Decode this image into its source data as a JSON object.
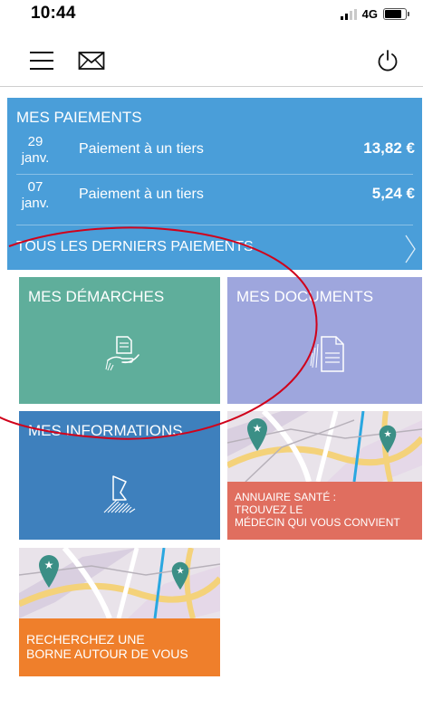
{
  "status": {
    "time": "10:44",
    "network": "4G"
  },
  "payments": {
    "title": "MES PAIEMENTS",
    "rows": [
      {
        "day": "29",
        "month": "janv.",
        "label": "Paiement à un tiers",
        "amount": "13,82 €"
      },
      {
        "day": "07",
        "month": "janv.",
        "label": "Paiement à un tiers",
        "amount": "5,24 €"
      }
    ],
    "all_label": "TOUS LES DERNIERS PAIEMENTS"
  },
  "tiles": {
    "demarches": "MES DÉMARCHES",
    "documents": "MES DOCUMENTS",
    "informations": "MES INFORMATIONS",
    "annuaire": [
      "ANNUAIRE SANTÉ :",
      "TROUVEZ LE",
      "MÉDECIN QUI VOUS CONVIENT"
    ],
    "borne": [
      "RECHERCHEZ UNE",
      "BORNE AUTOUR DE VOUS"
    ]
  },
  "colors": {
    "payments": "#4a9ed9",
    "demarches": "#5fae9b",
    "documents": "#9ea6dd",
    "informations": "#3e80bd",
    "annuaire": "#e06e5f",
    "borne": "#ef7f2b",
    "annotation": "#d0021b"
  },
  "icons": {
    "menu": "hamburger-icon",
    "mail": "mail-icon",
    "power": "power-icon",
    "demarches": "hand-document-icon",
    "documents": "document-icon",
    "informations": "person-icon",
    "map": "map-pin-icon"
  }
}
